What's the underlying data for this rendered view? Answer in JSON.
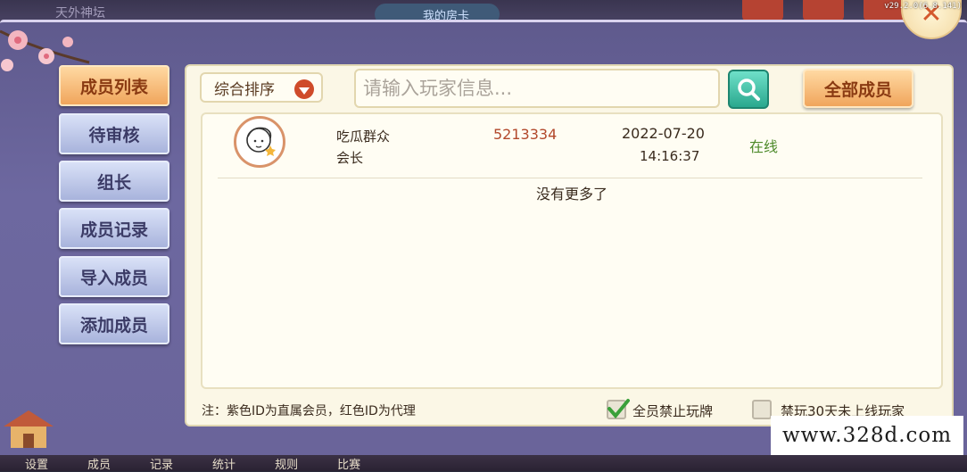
{
  "background": {
    "title": "天外神坛",
    "room_card": "我的房卡",
    "version": "v29.2.0(6.8.141)"
  },
  "sidebar": {
    "items": [
      {
        "label": "成员列表",
        "active": true
      },
      {
        "label": "待审核",
        "active": false
      },
      {
        "label": "组长",
        "active": false
      },
      {
        "label": "成员记录",
        "active": false
      },
      {
        "label": "导入成员",
        "active": false
      },
      {
        "label": "添加成员",
        "active": false
      }
    ]
  },
  "toolbar": {
    "sort_label": "综合排序",
    "search_placeholder": "请输入玩家信息...",
    "all_members_label": "全部成员"
  },
  "members": [
    {
      "name": "吃瓜群众",
      "role": "会长",
      "id": "5213334",
      "date": "2022-07-20",
      "time": "14:16:37",
      "status": "在线"
    }
  ],
  "list_footer": "没有更多了",
  "footer": {
    "note": "注：紫色ID为直属会员，红色ID为代理",
    "ban_all_label": "全员禁止玩牌",
    "ban_all_checked": true,
    "ban_inactive_label": "禁玩30天未上线玩家",
    "ban_inactive_checked": false
  },
  "bottom_nav": [
    "设置",
    "成员",
    "记录",
    "统计",
    "规则",
    "比赛"
  ],
  "watermark": "www.328d.com",
  "colors": {
    "active_tab": "#f0a55c",
    "tab": "#a8b3dc",
    "member_id": "#b2482b",
    "online": "#4d8a2a",
    "search_button": "#2aa88e"
  }
}
